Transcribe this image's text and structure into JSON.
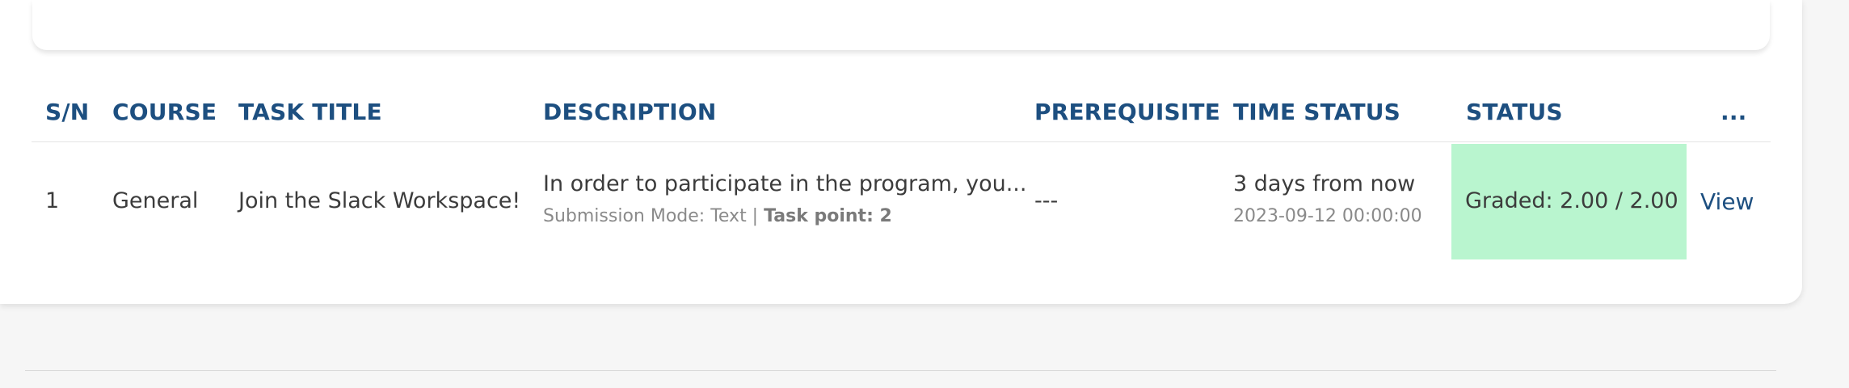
{
  "table": {
    "headers": {
      "sn": "S/N",
      "course": "COURSE",
      "task_title": "TASK TITLE",
      "description": "DESCRIPTION",
      "prerequisite": "PREREQUISITE",
      "time_status": "TIME STATUS",
      "status": "STATUS",
      "actions": "..."
    },
    "rows": [
      {
        "sn": "1",
        "course": "General",
        "task_title": "Join the Slack Workspace!",
        "description": "In order to participate in the program, you...",
        "submission_mode_prefix": "Submission Mode: Text | ",
        "task_point": "Task point: 2",
        "prerequisite": "---",
        "time_relative": "3 days from now",
        "time_absolute": "2023-09-12 00:00:00",
        "status": "Graded: 2.00 / 2.00",
        "action": "View"
      }
    ]
  },
  "colors": {
    "header_text": "#1d4f80",
    "status_bg": "#b9f5cf",
    "page_bg": "#f6f6f6"
  }
}
